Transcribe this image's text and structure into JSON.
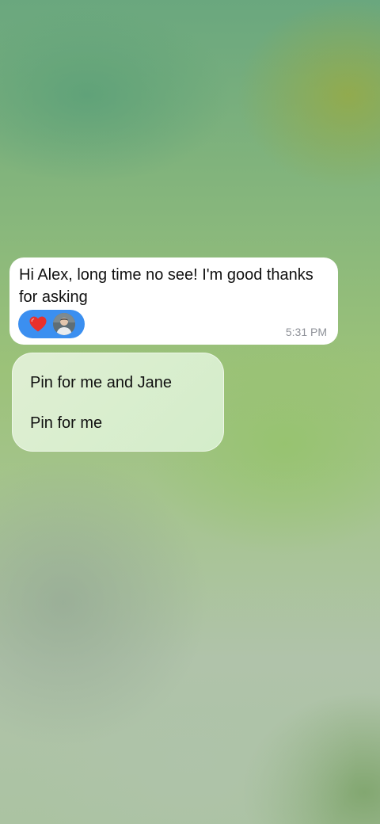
{
  "message": {
    "text": "Hi Alex, long time no see! I'm good thanks for asking",
    "time": "5:31 PM",
    "reaction": {
      "emoji": "❤",
      "icon": "heart-icon",
      "color": "#e8302c",
      "pill_color": "#3b8ff0"
    }
  },
  "context_menu": {
    "items": [
      {
        "label": "Pin for me and Jane"
      },
      {
        "label": "Pin for me"
      }
    ]
  },
  "colors": {
    "bubble": "#ffffff",
    "menu": "#dff0d5",
    "time": "#8e9198"
  }
}
